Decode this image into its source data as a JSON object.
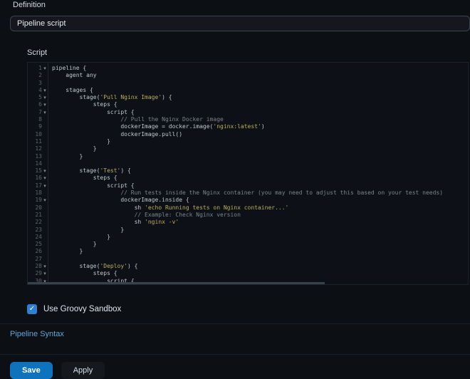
{
  "definition": {
    "label": "Definition",
    "value": "Pipeline script"
  },
  "script_section": {
    "label": "Script"
  },
  "sandbox": {
    "label": "Use Groovy Sandbox",
    "checked": true,
    "check_glyph": "✓"
  },
  "links": {
    "pipeline_syntax": "Pipeline Syntax"
  },
  "actions": {
    "save": "Save",
    "apply": "Apply"
  },
  "colors": {
    "background": "#0c0f13",
    "editor_background": "#0d1117",
    "accent_blue": "#0f72bd",
    "checkbox_blue": "#2f80d0",
    "link_blue": "#61a7dd",
    "string_token": "#bfae54",
    "comment_token": "#7b838d",
    "default_token": "#bfc7d0"
  },
  "editor": {
    "fold_glyph": "▾",
    "lines": [
      {
        "n": 1,
        "fold": true,
        "segs": [
          [
            "d",
            "pipeline {"
          ]
        ]
      },
      {
        "n": 2,
        "fold": false,
        "segs": [
          [
            "d",
            "    agent any"
          ]
        ]
      },
      {
        "n": 3,
        "fold": false,
        "segs": []
      },
      {
        "n": 4,
        "fold": true,
        "segs": [
          [
            "d",
            "    stages {"
          ]
        ]
      },
      {
        "n": 5,
        "fold": true,
        "segs": [
          [
            "d",
            "        stage("
          ],
          [
            "s",
            "'Pull Nginx Image'"
          ],
          [
            "d",
            ") {"
          ]
        ]
      },
      {
        "n": 6,
        "fold": true,
        "segs": [
          [
            "d",
            "            steps {"
          ]
        ]
      },
      {
        "n": 7,
        "fold": true,
        "segs": [
          [
            "d",
            "                script {"
          ]
        ]
      },
      {
        "n": 8,
        "fold": false,
        "segs": [
          [
            "c",
            "                    // Pull the Nginx Docker image"
          ]
        ]
      },
      {
        "n": 9,
        "fold": false,
        "segs": [
          [
            "d",
            "                    dockerImage = docker.image("
          ],
          [
            "s",
            "'nginx:latest'"
          ],
          [
            "d",
            ")"
          ]
        ]
      },
      {
        "n": 10,
        "fold": false,
        "segs": [
          [
            "d",
            "                    dockerImage.pull()"
          ]
        ]
      },
      {
        "n": 11,
        "fold": false,
        "segs": [
          [
            "d",
            "                }"
          ]
        ]
      },
      {
        "n": 12,
        "fold": false,
        "segs": [
          [
            "d",
            "            }"
          ]
        ]
      },
      {
        "n": 13,
        "fold": false,
        "segs": [
          [
            "d",
            "        }"
          ]
        ]
      },
      {
        "n": 14,
        "fold": false,
        "segs": []
      },
      {
        "n": 15,
        "fold": true,
        "segs": [
          [
            "d",
            "        stage("
          ],
          [
            "s",
            "'Test'"
          ],
          [
            "d",
            ") {"
          ]
        ]
      },
      {
        "n": 16,
        "fold": true,
        "segs": [
          [
            "d",
            "            steps {"
          ]
        ]
      },
      {
        "n": 17,
        "fold": true,
        "segs": [
          [
            "d",
            "                script {"
          ]
        ]
      },
      {
        "n": 18,
        "fold": false,
        "segs": [
          [
            "c",
            "                    // Run tests inside the Nginx container (you may need to adjust this based on your test needs)"
          ]
        ]
      },
      {
        "n": 19,
        "fold": true,
        "segs": [
          [
            "d",
            "                    dockerImage.inside {"
          ]
        ]
      },
      {
        "n": 20,
        "fold": false,
        "segs": [
          [
            "d",
            "                        sh "
          ],
          [
            "s",
            "'echo Running tests on Nginx container...'"
          ]
        ]
      },
      {
        "n": 21,
        "fold": false,
        "segs": [
          [
            "c",
            "                        // Example: Check Nginx version"
          ]
        ]
      },
      {
        "n": 22,
        "fold": false,
        "segs": [
          [
            "d",
            "                        sh "
          ],
          [
            "s",
            "'nginx -v'"
          ]
        ]
      },
      {
        "n": 23,
        "fold": false,
        "segs": [
          [
            "d",
            "                    }"
          ]
        ]
      },
      {
        "n": 24,
        "fold": false,
        "segs": [
          [
            "d",
            "                }"
          ]
        ]
      },
      {
        "n": 25,
        "fold": false,
        "segs": [
          [
            "d",
            "            }"
          ]
        ]
      },
      {
        "n": 26,
        "fold": false,
        "segs": [
          [
            "d",
            "        }"
          ]
        ]
      },
      {
        "n": 27,
        "fold": false,
        "segs": []
      },
      {
        "n": 28,
        "fold": true,
        "segs": [
          [
            "d",
            "        stage("
          ],
          [
            "s",
            "'Deploy'"
          ],
          [
            "d",
            ") {"
          ]
        ]
      },
      {
        "n": 29,
        "fold": true,
        "segs": [
          [
            "d",
            "            steps {"
          ]
        ]
      },
      {
        "n": 30,
        "fold": true,
        "segs": [
          [
            "d",
            "                script {"
          ]
        ]
      }
    ]
  }
}
